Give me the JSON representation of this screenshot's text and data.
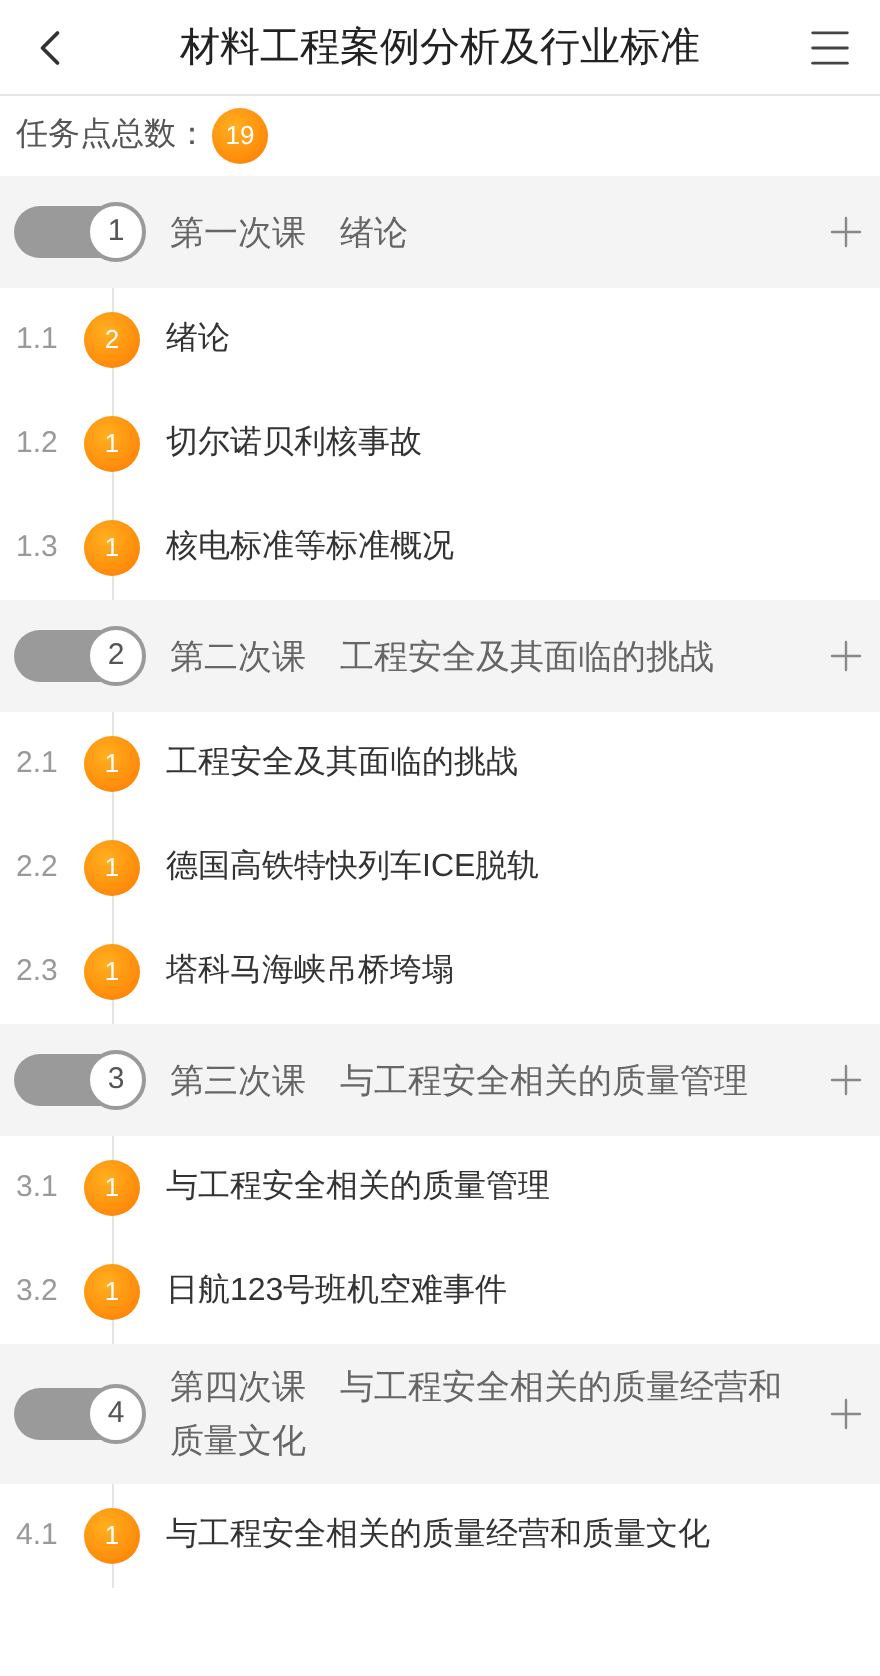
{
  "header": {
    "title": "材料工程案例分析及行业标准"
  },
  "task_total": {
    "label": "任务点总数：",
    "count": "19"
  },
  "lessons": [
    {
      "number": "1",
      "title": "第一次课　绪论",
      "items": [
        {
          "index": "1.1",
          "count": "2",
          "title": "绪论"
        },
        {
          "index": "1.2",
          "count": "1",
          "title": "切尔诺贝利核事故"
        },
        {
          "index": "1.3",
          "count": "1",
          "title": "核电标准等标准概况"
        }
      ]
    },
    {
      "number": "2",
      "title": "第二次课　工程安全及其面临的挑战",
      "items": [
        {
          "index": "2.1",
          "count": "1",
          "title": "工程安全及其面临的挑战"
        },
        {
          "index": "2.2",
          "count": "1",
          "title": "德国高铁特快列车ICE脱轨"
        },
        {
          "index": "2.3",
          "count": "1",
          "title": "塔科马海峡吊桥垮塌"
        }
      ]
    },
    {
      "number": "3",
      "title": "第三次课　与工程安全相关的质量管理",
      "items": [
        {
          "index": "3.1",
          "count": "1",
          "title": "与工程安全相关的质量管理"
        },
        {
          "index": "3.2",
          "count": "1",
          "title": "日航123号班机空难事件"
        }
      ]
    },
    {
      "number": "4",
      "title": "第四次课　与工程安全相关的质量经营和质量文化",
      "items": [
        {
          "index": "4.1",
          "count": "1",
          "title": "与工程安全相关的质量经营和质量文化"
        }
      ]
    }
  ]
}
